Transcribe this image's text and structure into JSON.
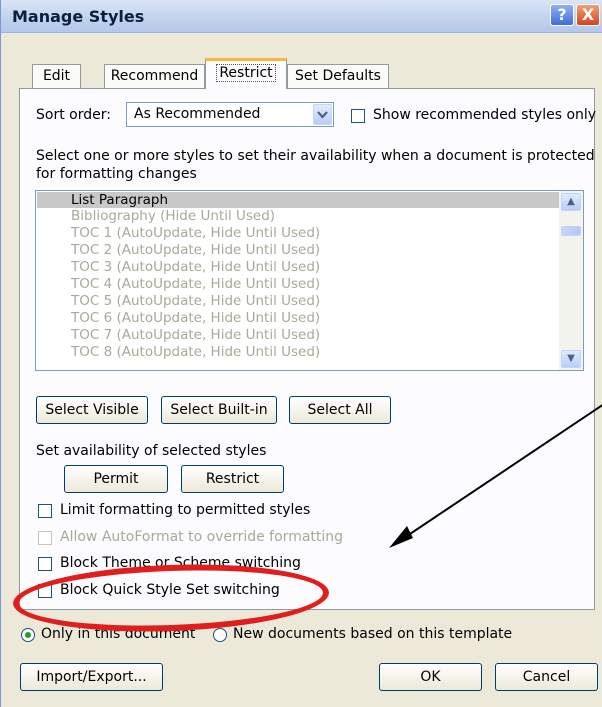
{
  "window": {
    "title": "Manage Styles",
    "help_glyph": "?",
    "close_glyph": "X"
  },
  "tabs": [
    {
      "label": "Edit",
      "active": false
    },
    {
      "label": "Recommend",
      "active": false
    },
    {
      "label": "Restrict",
      "active": true
    },
    {
      "label": "Set Defaults",
      "active": false
    }
  ],
  "sort": {
    "label": "Sort order:",
    "value": "As Recommended",
    "show_recommended_label": "Show recommended styles only",
    "show_recommended_checked": false
  },
  "instructions": [
    "Select one or more styles to set their availability when a document is protected",
    "for formatting changes"
  ],
  "styles_list": [
    "List Paragraph",
    "Bibliography  (Hide Until Used)",
    "TOC 1  (AutoUpdate, Hide Until Used)",
    "TOC 2  (AutoUpdate, Hide Until Used)",
    "TOC 3  (AutoUpdate, Hide Until Used)",
    "TOC 4  (AutoUpdate, Hide Until Used)",
    "TOC 5  (AutoUpdate, Hide Until Used)",
    "TOC 6  (AutoUpdate, Hide Until Used)",
    "TOC 7  (AutoUpdate, Hide Until Used)",
    "TOC 8  (AutoUpdate, Hide Until Used)"
  ],
  "select_buttons": {
    "visible": "Select Visible",
    "builtin": "Select Built-in",
    "all": "Select All"
  },
  "availability": {
    "label": "Set availability of selected styles",
    "permit": "Permit",
    "restrict": "Restrict"
  },
  "options": {
    "limit_formatting": "Limit formatting to permitted styles",
    "allow_autoformat": "Allow AutoFormat to override formatting",
    "block_theme": "Block Theme or Scheme switching",
    "block_quick_style": "Block Quick Style Set switching"
  },
  "scope": {
    "only_this_doc": "Only in this document",
    "new_docs": "New documents based on this template",
    "selected": "only_this_doc"
  },
  "footer": {
    "import_export": "Import/Export...",
    "ok": "OK",
    "cancel": "Cancel"
  },
  "colors": {
    "highlight_oval": "#e01e1e",
    "selected_row": "#c8c8c8",
    "disabled_text": "#aca899"
  }
}
